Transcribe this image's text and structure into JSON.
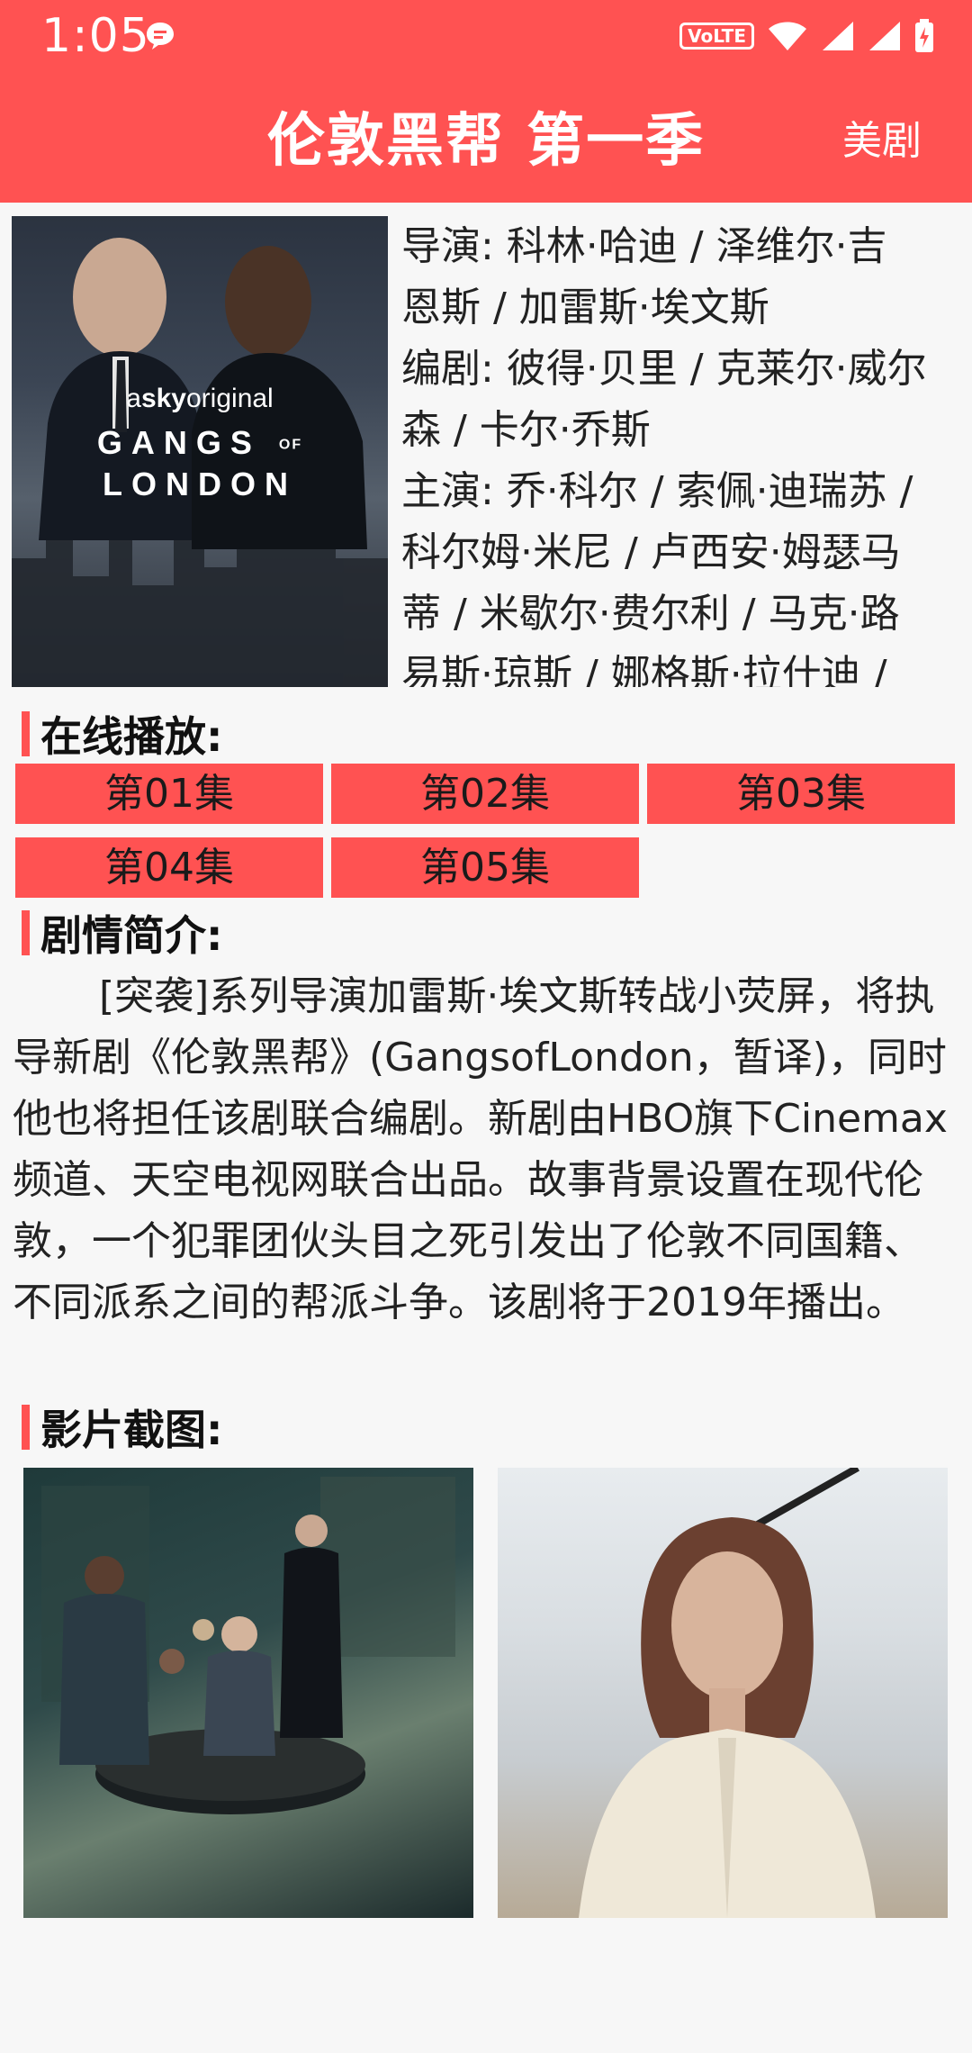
{
  "status_bar": {
    "time": "1:05",
    "volte": "VoLTE"
  },
  "app_bar": {
    "title": "伦敦黑帮 第一季",
    "action": "美剧"
  },
  "poster": {
    "brand_prefix": "a",
    "brand": "sky",
    "brand_suffix": "original",
    "title_line1": "GANGS",
    "title_of": "OF",
    "title_line2": "LONDON"
  },
  "info": {
    "lines": [
      "导演: 科林·哈迪 / 泽维尔·吉",
      "恩斯 / 加雷斯·埃文斯",
      "编剧: 彼得·贝里 / 克莱尔·威尔",
      "森 / 卡尔·乔斯",
      "主演: 乔·科尔 / 索佩·迪瑞苏 /",
      "科尔姆·米尼 / 卢西安·姆瑟马",
      "蒂 / 米歇尔·费尔利 / 马克·路",
      "易斯·琼斯 / 娜格斯·拉什迪 /"
    ]
  },
  "sections": {
    "online": "在线播放:",
    "synopsis": "剧情简介:",
    "stills": "影片截图:"
  },
  "episodes": [
    "第01集",
    "第02集",
    "第03集",
    "第04集",
    "第05集"
  ],
  "synopsis_text": "[突袭]系列导演加雷斯·埃文斯转战小荧屏，将执导新剧《伦敦黑帮》(GangsofLondon，暂译)，同时他也将担任该剧联合编剧。新剧由HBO旗下Cinemax频道、天空电视网联合出品。故事背景设置在现代伦敦，一个犯罪团伙头目之死引发出了伦敦不同国籍、不同派系之间的帮派斗争。该剧将于2019年播出。",
  "colors": {
    "accent": "#ff5252",
    "background": "#f7f7f7"
  }
}
